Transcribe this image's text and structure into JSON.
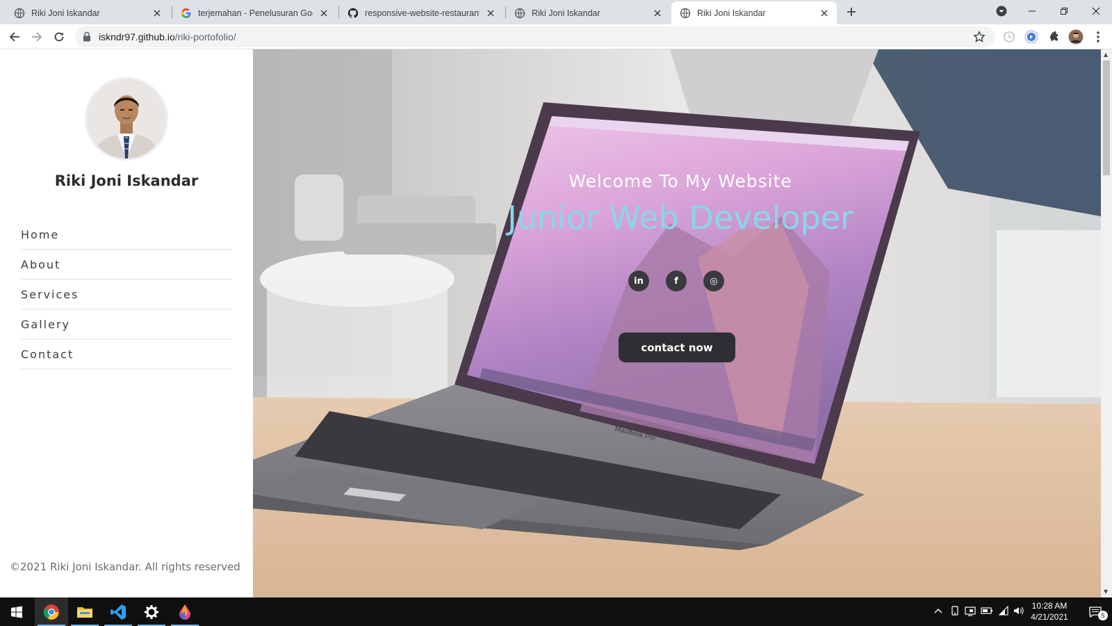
{
  "browser": {
    "tabs": [
      {
        "title": "Riki Joni Iskandar",
        "icon": "globe-icon",
        "active": false
      },
      {
        "title": "terjemahan - Penelusuran Google",
        "icon": "google-icon",
        "active": false
      },
      {
        "title": "responsive-website-restaurant/st",
        "icon": "github-icon",
        "active": false
      },
      {
        "title": "Riki Joni Iskandar",
        "icon": "globe-icon",
        "active": false
      },
      {
        "title": "Riki Joni Iskandar",
        "icon": "globe-icon",
        "active": true
      }
    ],
    "url_host": "iskndr97.github.io",
    "url_path": "/riki-portofolio/"
  },
  "sidebar": {
    "name": "Riki Joni Iskandar",
    "nav": [
      "Home",
      "About",
      "Services",
      "Gallery",
      "Contact"
    ],
    "copyright": "©2021 Riki Joni Iskandar. All rights reserved"
  },
  "hero": {
    "welcome": "Welcome To My Website",
    "role": "Junior Web Developer",
    "socials": [
      {
        "icon": "linkedin-icon",
        "glyph": "in"
      },
      {
        "icon": "facebook-icon",
        "glyph": "f"
      },
      {
        "icon": "instagram-icon",
        "glyph": "◎"
      }
    ],
    "contact_button": "contact now",
    "laptop_label": "MacBook Pro",
    "role_color": "#8ad6e8"
  },
  "taskbar": {
    "apps": [
      "windows-start-icon",
      "chrome-icon",
      "file-explorer-icon",
      "vscode-icon",
      "settings-icon",
      "paint-drop-icon"
    ],
    "time": "10:28 AM",
    "date": "4/21/2021",
    "notifications": "5"
  }
}
